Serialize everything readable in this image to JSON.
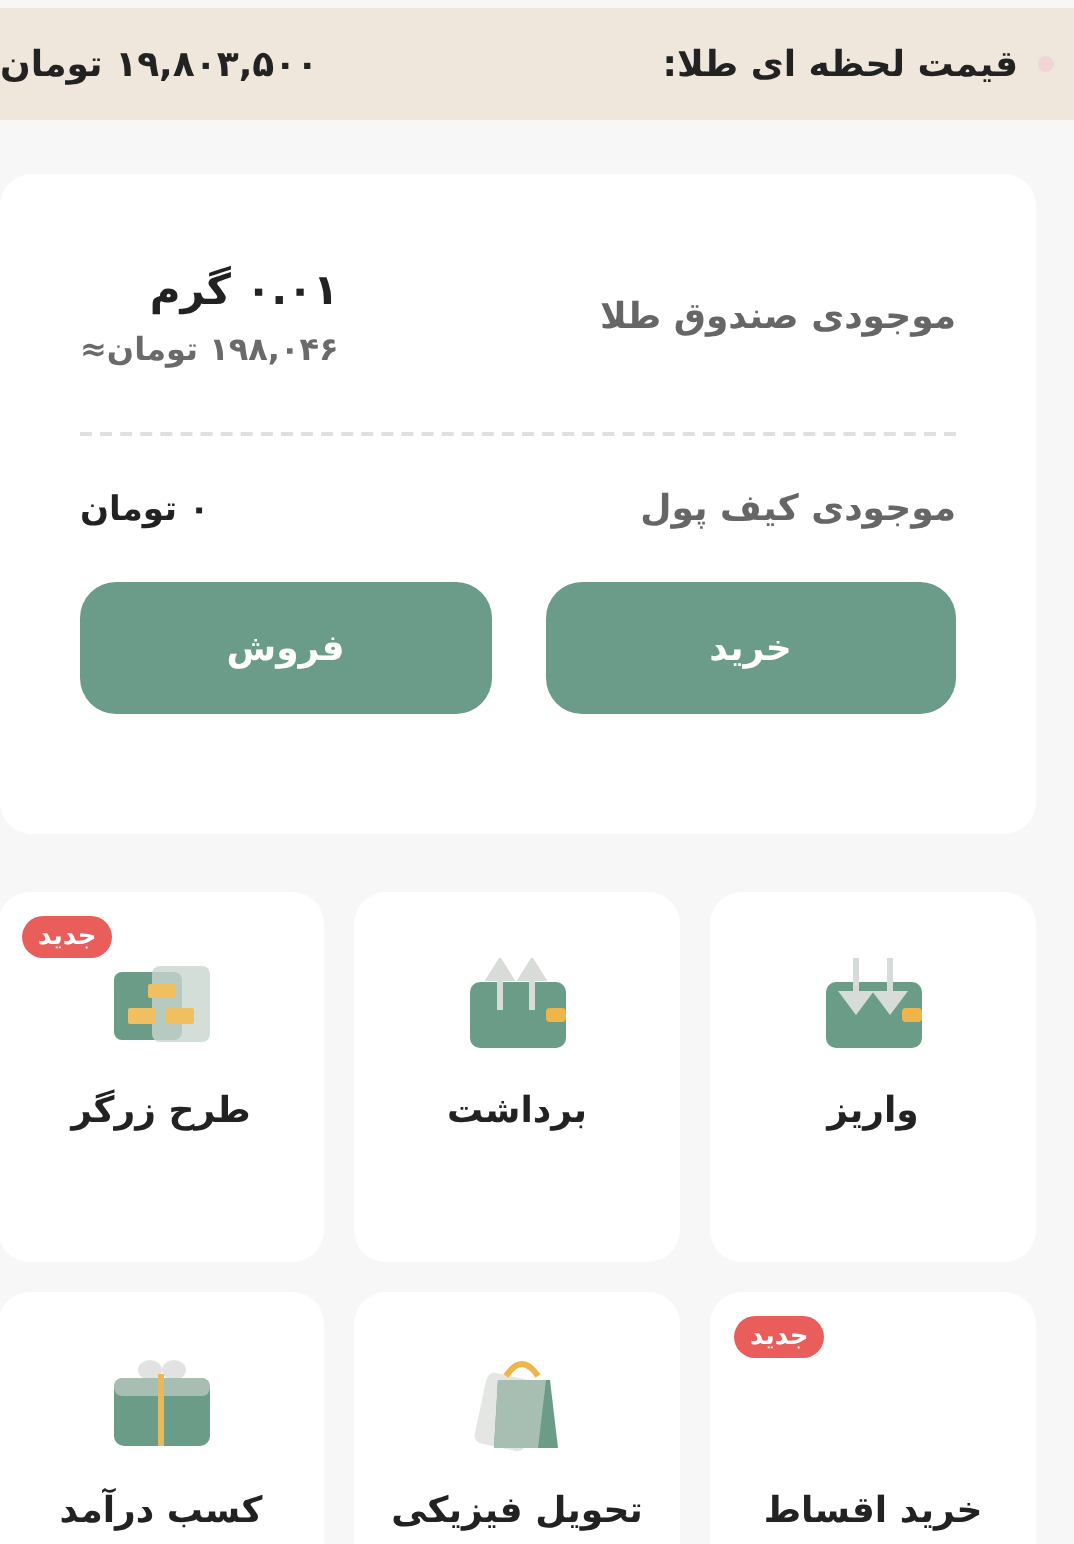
{
  "price_bar": {
    "label": "قیمت لحظه ای طلا:",
    "value": "۱۹,۸۰۳,۵۰۰ تومان"
  },
  "balance_card": {
    "gold_label": "موجودی صندوق طلا",
    "gold_amount": "۰.۰۱ گرم",
    "gold_value": "۱۹۸,۰۴۶ تومان≈",
    "wallet_label": "موجودی کیف پول",
    "wallet_amount": "۰ تومان",
    "buttons": [
      "خرید",
      "فروش"
    ]
  },
  "tiles": [
    {
      "kind": "deposit",
      "label": "واریز"
    },
    {
      "kind": "withdraw",
      "label": "برداشت"
    },
    {
      "kind": "gold",
      "label": "طرح زرگر",
      "badge": "جدید"
    },
    {
      "kind": "installment",
      "label": "خرید اقساط",
      "badge": "جدید"
    },
    {
      "kind": "delivery",
      "label": "تحویل فیزیکی"
    },
    {
      "kind": "gift",
      "label": "کسب درآمد"
    }
  ]
}
